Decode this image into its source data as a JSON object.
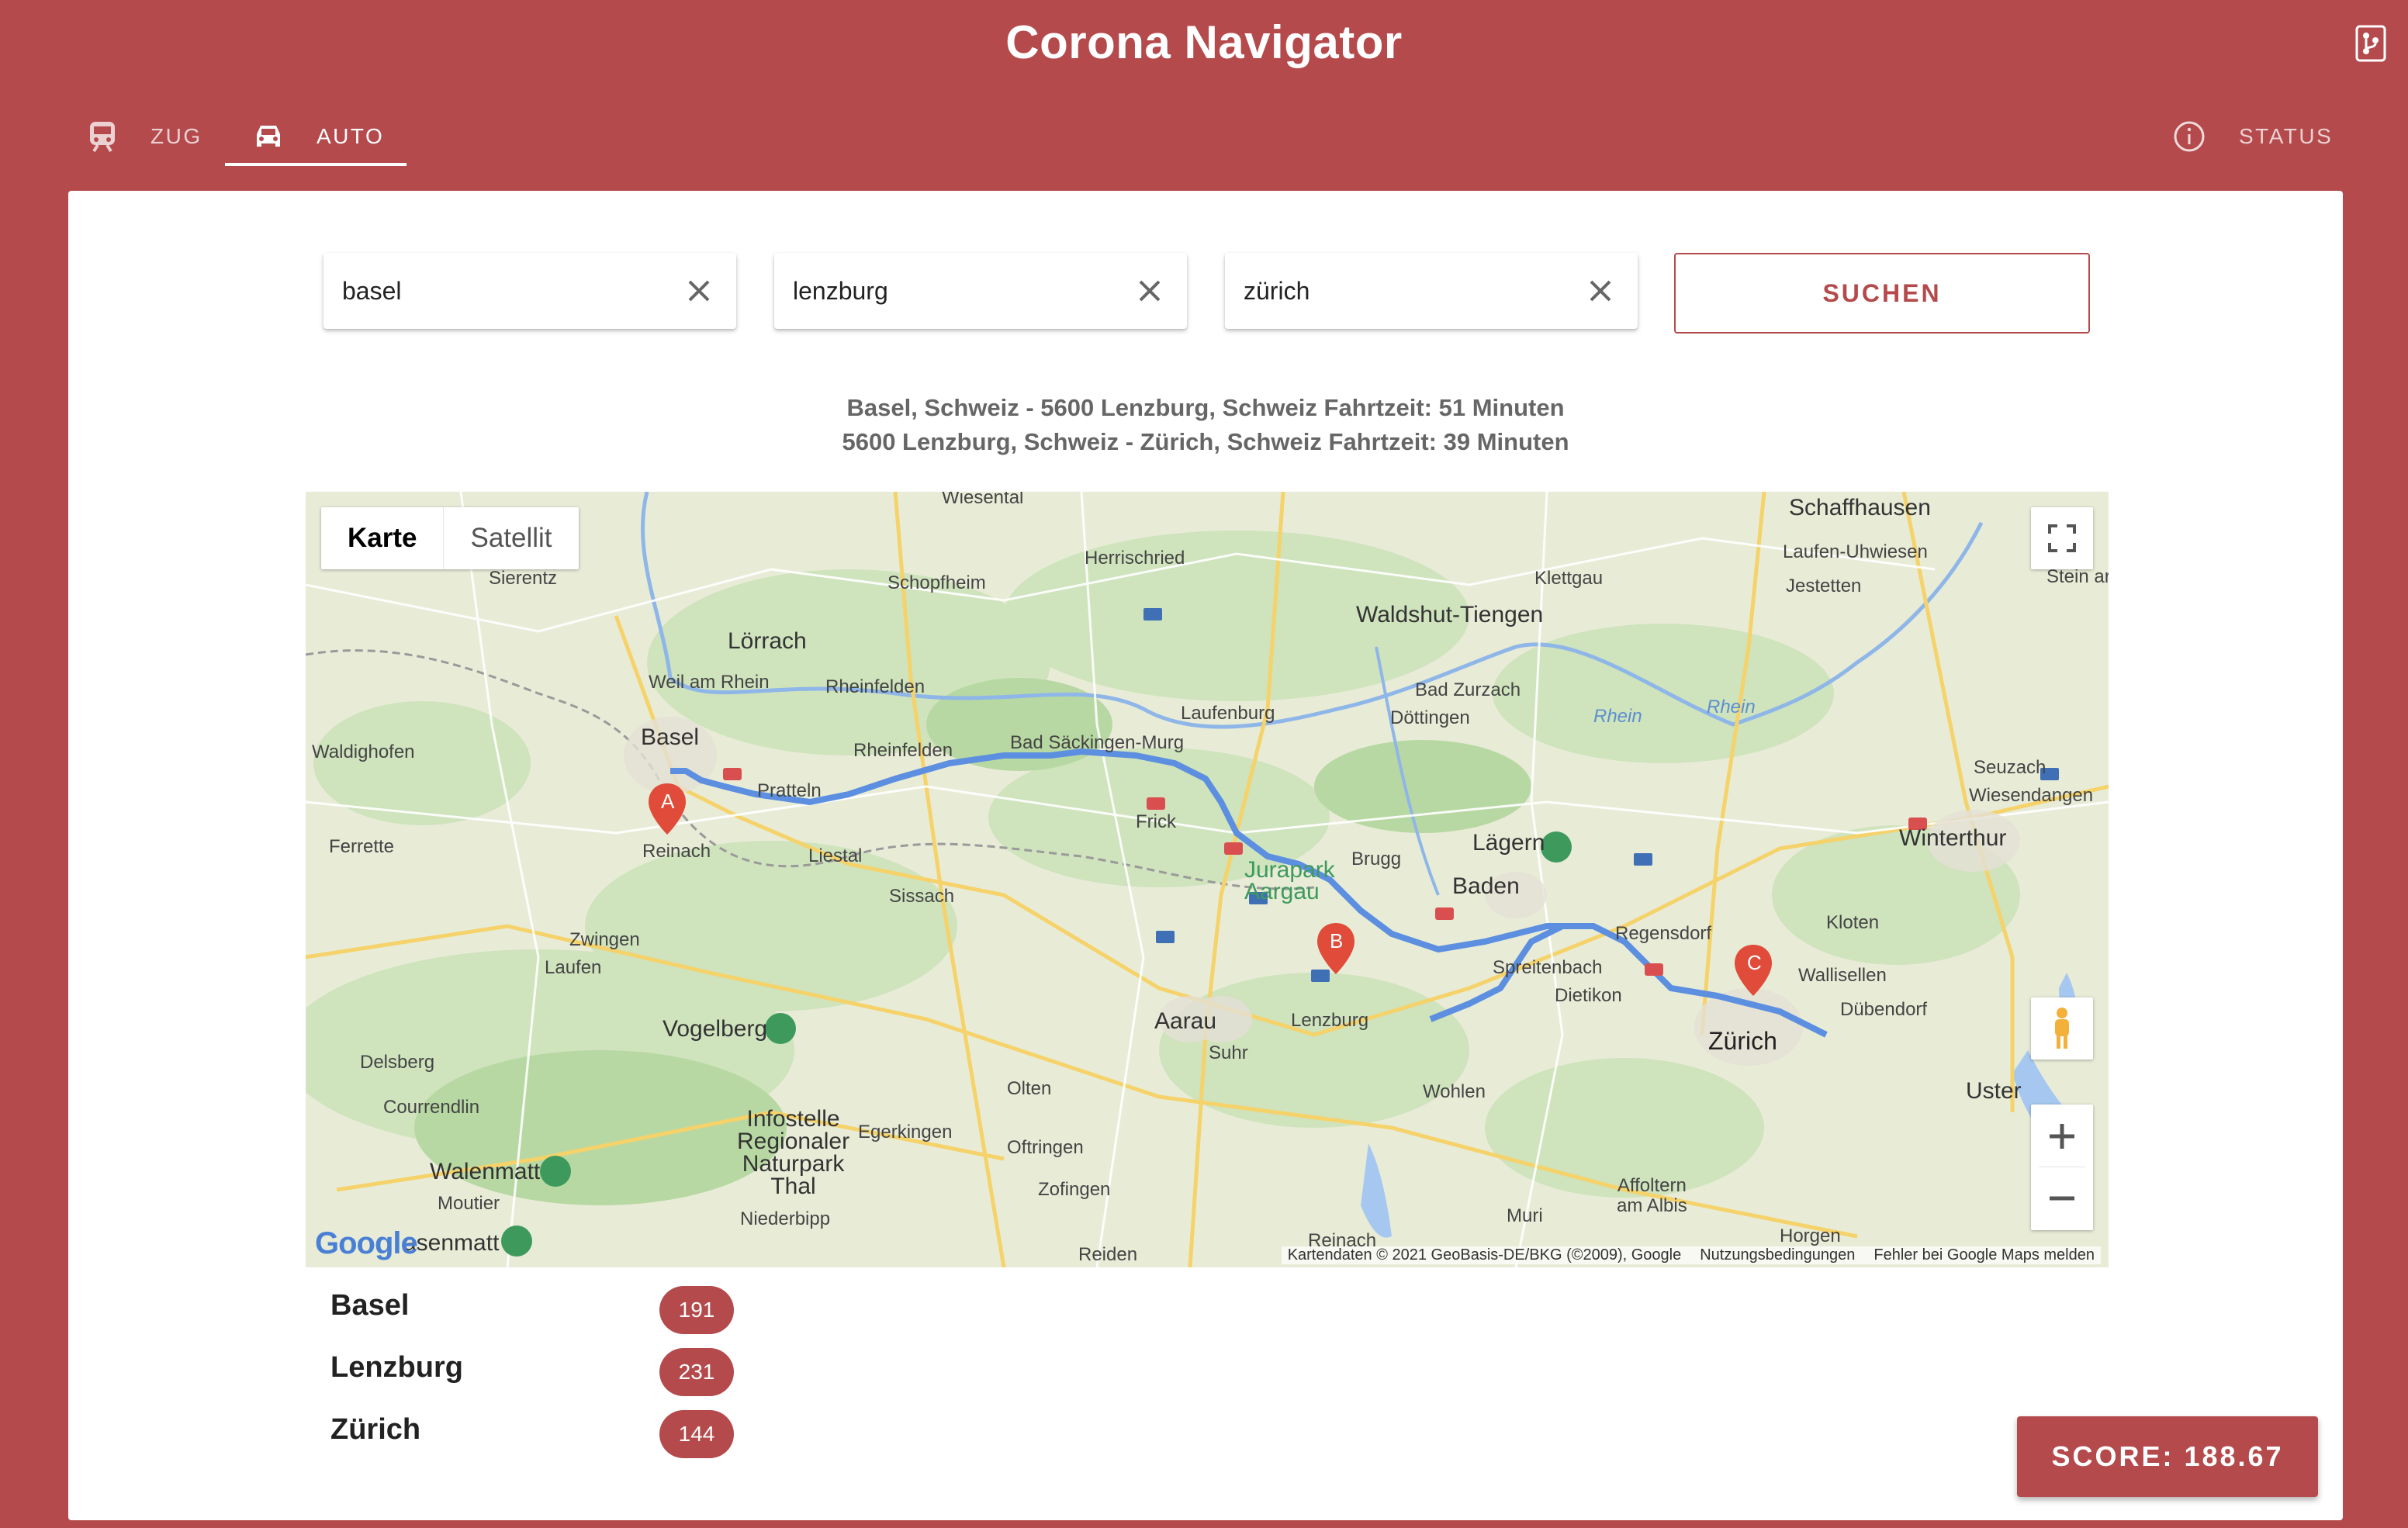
{
  "app": {
    "title": "Corona Navigator",
    "accent_color": "#b54a4c"
  },
  "tabs": [
    {
      "label": "ZUG",
      "icon": "train-icon",
      "active": false
    },
    {
      "label": "AUTO",
      "icon": "car-icon",
      "active": true
    },
    {
      "label": "STATUS",
      "icon": "info-icon",
      "active": false
    }
  ],
  "search": {
    "fields": [
      {
        "value": "basel",
        "placeholder": ""
      },
      {
        "value": "lenzburg",
        "placeholder": ""
      },
      {
        "value": "zürich",
        "placeholder": ""
      }
    ],
    "button_label": "SUCHEN"
  },
  "routes": [
    "Basel, Schweiz - 5600 Lenzburg, Schweiz Fahrtzeit: 51 Minuten",
    "5600 Lenzburg, Schweiz - Zürich, Schweiz Fahrtzeit: 39 Minuten"
  ],
  "map": {
    "type_buttons": [
      "Karte",
      "Satellit"
    ],
    "active_type": "Karte",
    "markers": [
      "A",
      "B",
      "C"
    ],
    "labels": {
      "wiesental": "Wiesental",
      "schaffhausen": "Schaffhausen",
      "sierentz": "Sierentz",
      "schopfheim": "Schopfheim",
      "herrischried": "Herrischried",
      "laufen_uhwiesen": "Laufen-Uhwiesen",
      "klettgau": "Klettgau",
      "jestetten": "Jestetten",
      "stein_am": "Stein ar",
      "loerrach": "Lörrach",
      "waldshut": "Waldshut-Tiengen",
      "weil_am_rhein": "Weil am Rhein",
      "rheinfelden_de": "Rheinfelden",
      "bad_zurzach": "Bad Zurzach",
      "laufenburg": "Laufenburg",
      "doettingen": "Döttingen",
      "rhein1": "Rhein",
      "rhein2": "Rhein",
      "basel": "Basel",
      "waldighofen": "Waldighofen",
      "rheinfelden_ch": "Rheinfelden",
      "bad_saeckingen": "Bad Säckingen-Murg",
      "seuzach": "Seuzach",
      "wiesendangen": "Wiesendangen",
      "pratteln": "Pratteln",
      "frick": "Frick",
      "laegern": "Lägern",
      "winterthur": "Winterthur",
      "ferrette": "Ferrette",
      "reinach": "Reinach",
      "liestal": "Liestal",
      "brugg": "Brugg",
      "jurapark": "Jurapark\nAargau",
      "baden": "Baden",
      "sissach": "Sissach",
      "regensdorf": "Regensdorf",
      "kloten": "Kloten",
      "zwingen": "Zwingen",
      "laufen": "Laufen",
      "spreitenbach": "Spreitenbach",
      "wallisellen": "Wallisellen",
      "dietikon": "Dietikon",
      "duebendorf": "Dübendorf",
      "vogelberg": "Vogelberg",
      "aarau": "Aarau",
      "lenzburg": "Lenzburg",
      "zuerich": "Zürich",
      "delsberg": "Delsberg",
      "suhr": "Suhr",
      "courrendlin": "Courrendlin",
      "olten": "Olten",
      "wohlen": "Wohlen",
      "uster": "Uster",
      "infostelle": "Infostelle\nRegionaler\nNaturpark\nThal",
      "egerkingen": "Egerkingen",
      "oftringen": "Oftringen",
      "walenmatt": "Walenmatt",
      "zofingen": "Zofingen",
      "affoltern": "Affoltern\nam Albis",
      "moutier": "Moutier",
      "niederbipp": "Niederbipp",
      "muri": "Muri",
      "horgen": "Horgen",
      "reiden": "Reiden",
      "reinach2": "Reinach",
      "senmatt": "asenmatt"
    },
    "footer": {
      "attribution": "Kartendaten © 2021 GeoBasis-DE/BKG (©2009), Google",
      "terms": "Nutzungsbedingungen",
      "report": "Fehler bei Google Maps melden"
    },
    "logo": "Google"
  },
  "stats": [
    {
      "name": "Basel",
      "value": "191"
    },
    {
      "name": "Lenzburg",
      "value": "231"
    },
    {
      "name": "Zürich",
      "value": "144"
    }
  ],
  "score_label": "SCORE: 188.67"
}
